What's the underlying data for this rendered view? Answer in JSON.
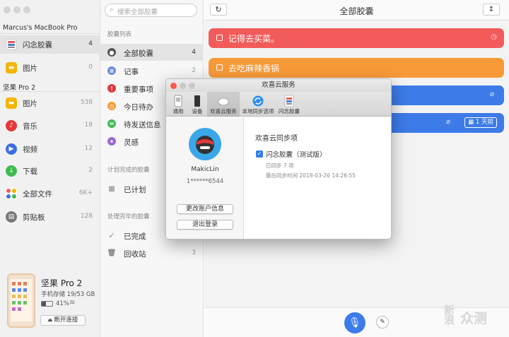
{
  "left": {
    "device1": "Marcus's MacBook Pro",
    "device1_items": [
      {
        "label": "闪念胶囊",
        "count": "4"
      },
      {
        "label": "图片",
        "count": "0"
      }
    ],
    "device2": "坚果 Pro 2",
    "device2_items": [
      {
        "label": "图片",
        "count": "538"
      },
      {
        "label": "音乐",
        "count": "18"
      },
      {
        "label": "视频",
        "count": "12"
      },
      {
        "label": "下载",
        "count": "2"
      },
      {
        "label": "全部文件",
        "count": "6K+"
      },
      {
        "label": "剪贴板",
        "count": "128"
      }
    ],
    "phone": {
      "name": "坚果 Pro 2",
      "storage": "手机存储 19/53 GB",
      "battery": "41%",
      "disconnect": "断开连接"
    }
  },
  "middle": {
    "search_placeholder": "搜索全部胶囊",
    "list_title": "胶囊列表",
    "items": [
      {
        "label": "全部胶囊",
        "count": "4"
      },
      {
        "label": "记事",
        "count": "2"
      },
      {
        "label": "重要事项",
        "count": ""
      },
      {
        "label": "今日待办",
        "count": ""
      },
      {
        "label": "待发送信息",
        "count": ""
      },
      {
        "label": "灵感",
        "count": ""
      }
    ],
    "planned_title": "计划完成的胶囊",
    "planned_item": "已计划",
    "done_title": "处理完毕的胶囊",
    "done_items": [
      {
        "label": "已完成",
        "count": ""
      },
      {
        "label": "回收站",
        "count": "3"
      }
    ]
  },
  "main": {
    "title": "全部胶囊",
    "cards": [
      {
        "text": "记得去买菜。",
        "color": "#f25b5b"
      },
      {
        "text": "去吃麻辣香锅",
        "color": "#f99a38"
      },
      {
        "text": "",
        "color": "#3d7be8"
      },
      {
        "text": "",
        "color": "#3d7be8"
      }
    ],
    "card4_badge": "1 天前"
  },
  "dialog": {
    "title": "欢喜云服务",
    "tabs": [
      "通用",
      "设备",
      "欢喜云服务",
      "本地同步选项",
      "闪念胶囊"
    ],
    "username": "MakicLin",
    "phone": "1******6544",
    "change_account": "更改账户信息",
    "logout": "退出登录",
    "sync_title": "欢喜云同步项",
    "sync_item": "闪念胶囊（测试版）",
    "synced": "已同步 7 项",
    "last_sync": "最后同步时间 2018-03-26 14:26:55"
  },
  "watermark": [
    "新",
    "浪",
    "众测"
  ],
  "colors": {
    "accent_blue": "#3d7be8",
    "red": "#f25b5b",
    "orange": "#f99a38"
  }
}
